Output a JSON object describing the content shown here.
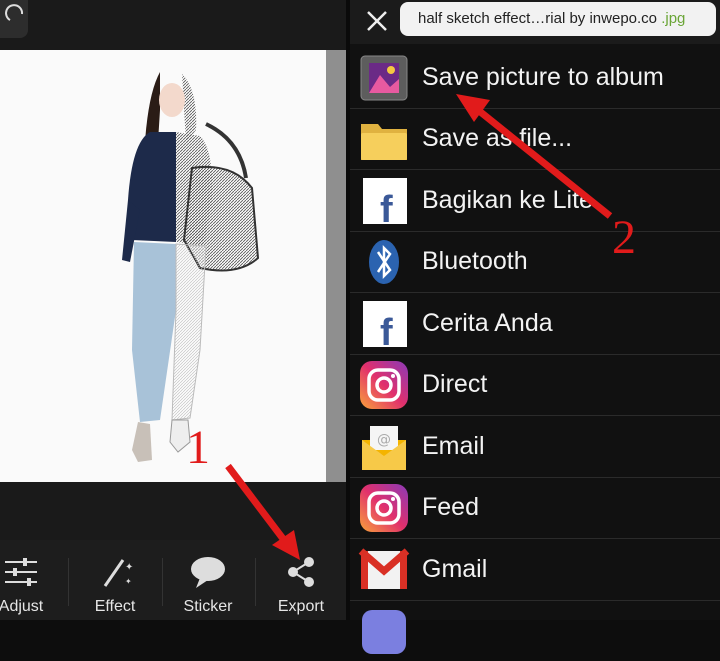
{
  "editor": {
    "toolbar": [
      {
        "label": "Adjust",
        "icon": "sliders-icon"
      },
      {
        "label": "Effect",
        "icon": "magic-wand-icon"
      },
      {
        "label": "Sticker",
        "icon": "speech-bubble-icon"
      },
      {
        "label": "Export",
        "icon": "share-icon"
      }
    ]
  },
  "share_sheet": {
    "close_icon": "close-icon",
    "filename": "half sketch effect…rial by inwepo.co",
    "extension": ".jpg",
    "items": [
      {
        "label": "Save picture to album",
        "icon": "gallery-icon"
      },
      {
        "label": "Save as file...",
        "icon": "folder-icon"
      },
      {
        "label": "Bagikan ke Lite",
        "icon": "facebook-icon"
      },
      {
        "label": "Bluetooth",
        "icon": "bluetooth-icon"
      },
      {
        "label": "Cerita Anda",
        "icon": "facebook-icon"
      },
      {
        "label": "Direct",
        "icon": "instagram-icon"
      },
      {
        "label": "Email",
        "icon": "email-icon"
      },
      {
        "label": "Feed",
        "icon": "instagram-icon"
      },
      {
        "label": "Gmail",
        "icon": "gmail-icon"
      }
    ]
  },
  "annotations": {
    "step1": "1",
    "step2": "2",
    "color": "#e11b1b"
  }
}
